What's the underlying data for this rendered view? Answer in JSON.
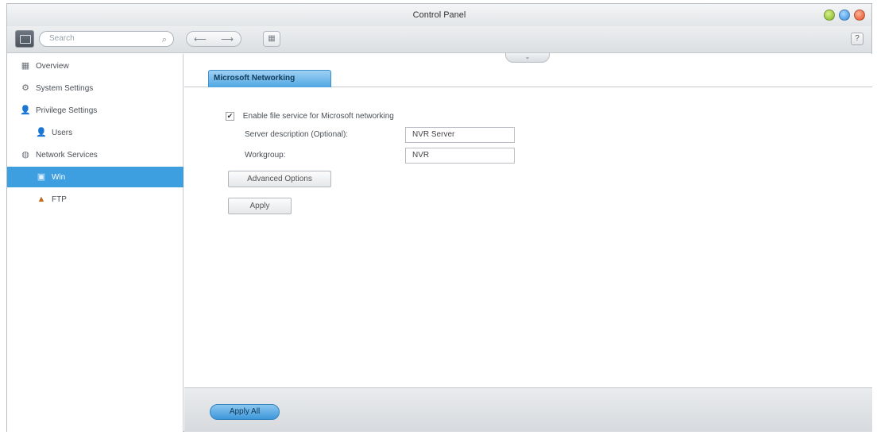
{
  "window": {
    "title": "Control Panel",
    "controls": {
      "minimize_color": "#7fb31f",
      "maximize_color": "#2e8ae0",
      "close_color": "#e24a1f"
    }
  },
  "toolbar": {
    "search_placeholder": "Search",
    "back_icon": "⟵",
    "forward_icon": "⟶",
    "grid_icon": "▦",
    "help_label": "?"
  },
  "sidebar": {
    "items": [
      {
        "label": "Overview",
        "icon": "overview-icon",
        "glyph": "▦"
      },
      {
        "label": "System Settings",
        "icon": "gear-icon",
        "glyph": "⚙"
      },
      {
        "label": "Privilege Settings",
        "icon": "user-icon",
        "glyph": "👤"
      },
      {
        "label": "Users",
        "icon": "user-icon",
        "glyph": "👤"
      },
      {
        "label": "Network Services",
        "icon": "globe-icon",
        "glyph": "◍"
      },
      {
        "label": "Win",
        "icon": "network-share-icon",
        "glyph": "▣"
      },
      {
        "label": "FTP",
        "icon": "ftp-icon",
        "glyph": "▲"
      }
    ],
    "active_color": "#3d9fe0"
  },
  "main": {
    "tab_label": "Microsoft Networking",
    "collapse_glyph": "⌄",
    "enable_label": "Enable file service for Microsoft networking",
    "enable_checked": true,
    "server_description_label": "Server description (Optional):",
    "server_description_value": "NVR Server",
    "workgroup_label": "Workgroup:",
    "workgroup_value": "NVR",
    "advanced_options_label": "Advanced Options",
    "apply_label": "Apply"
  },
  "footer": {
    "apply_all_label": "Apply All"
  }
}
